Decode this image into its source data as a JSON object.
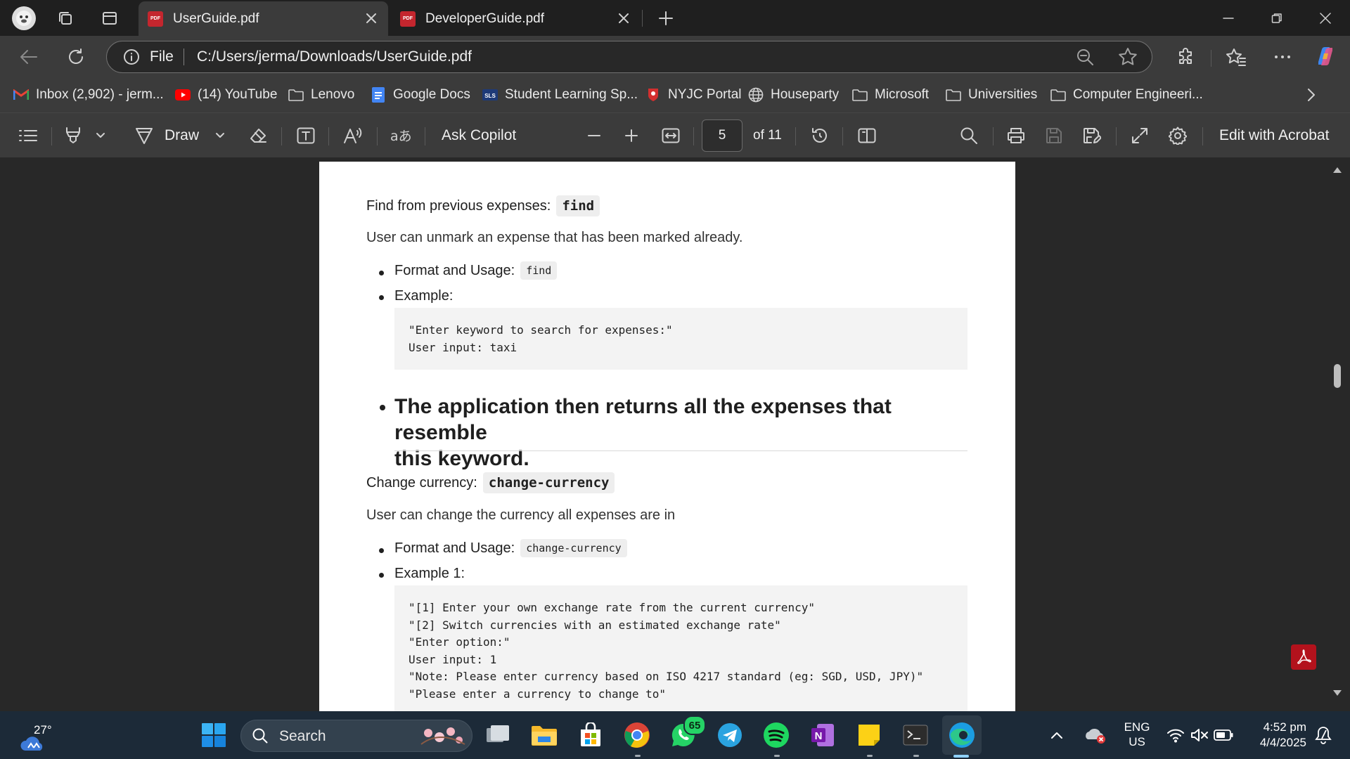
{
  "tabs": [
    {
      "label": "UserGuide.pdf",
      "active": true,
      "icon": "pdf-icon"
    },
    {
      "label": "DeveloperGuide.pdf",
      "active": false,
      "icon": "pdf-icon"
    }
  ],
  "address": {
    "scheme_label": "File",
    "url": "C:/Users/jerma/Downloads/UserGuide.pdf"
  },
  "bookmarks": [
    {
      "label": "Inbox (2,902) - jerm...",
      "icon": "gmail-icon"
    },
    {
      "label": "(14) YouTube",
      "icon": "youtube-icon"
    },
    {
      "label": "Lenovo",
      "icon": "folder-icon"
    },
    {
      "label": "Google Docs",
      "icon": "docs-icon"
    },
    {
      "label": "Student Learning Sp...",
      "icon": "sls-icon"
    },
    {
      "label": "NYJC Portal",
      "icon": "nyjc-icon"
    },
    {
      "label": "Houseparty",
      "icon": "globe-icon"
    },
    {
      "label": "Microsoft",
      "icon": "folder-icon"
    },
    {
      "label": "Universities",
      "icon": "folder-icon"
    },
    {
      "label": "Computer Engineeri...",
      "icon": "folder-icon"
    }
  ],
  "pdf_toolbar": {
    "draw_label": "Draw",
    "ask_copilot_label": "Ask Copilot",
    "page_number": "5",
    "page_total": "of 11",
    "edit_label": "Edit with Acrobat"
  },
  "document": {
    "find_section": {
      "heading": "Find from previous expenses:",
      "heading_code": "find",
      "description": "User can unmark an expense that has been marked already.",
      "format_label": "Format and Usage:",
      "format_code": "find",
      "example_label": "Example:",
      "code_lines": [
        "\"Enter keyword to search for expenses:\"",
        "User input: taxi"
      ],
      "result_line_1": "The application then returns all the expenses that resemble",
      "result_line_2": "this keyword."
    },
    "currency_section": {
      "heading": "Change currency:",
      "heading_code": "change-currency",
      "description": "User can change the currency all expenses are in",
      "format_label": "Format and Usage:",
      "format_code": "change-currency",
      "example_label": "Example 1:",
      "code_lines": [
        "\"[1] Enter your own exchange rate from the current currency\"",
        "\"[2] Switch currencies with an estimated exchange rate\"",
        "\"Enter option:\"",
        "User input: 1",
        "\"Note: Please enter currency based on ISO 4217 standard (eg: SGD, USD, JPY)\"",
        "\"Please enter a currency to change to\""
      ]
    }
  },
  "taskbar": {
    "weather_temp": "27°",
    "search_label": "Search",
    "whatsapp_badge": "65",
    "language_line1": "ENG",
    "language_line2": "US",
    "time": "4:52 pm",
    "date": "4/4/2025"
  },
  "colors": {
    "tab_active": "#3b3b3b",
    "chrome_dark": "#1f1f1f",
    "page_bg": "#ffffff",
    "pdf_red": "#c4262e",
    "taskbar": "#1c2a38"
  }
}
